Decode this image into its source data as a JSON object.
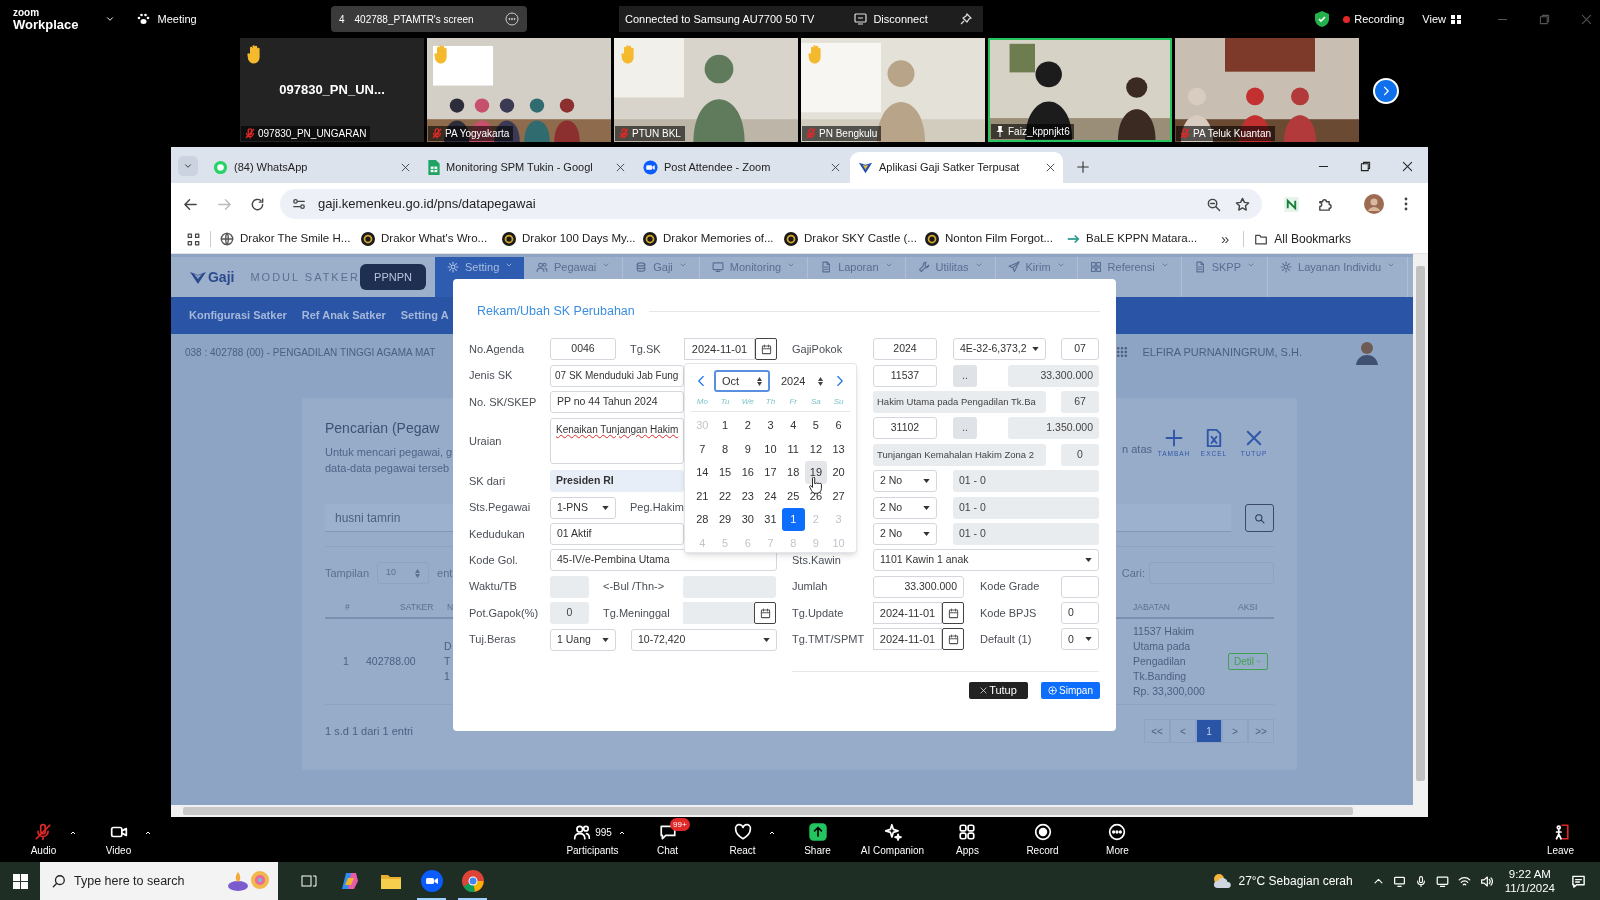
{
  "zoom_top_bar": {
    "logo_top": "zoom",
    "logo_bottom": "Workplace",
    "meeting": "Meeting",
    "share_count": "4",
    "share_label": "402788_PTAMTR's screen",
    "cast_status": "Connected to Samsung AU7700 50 TV",
    "disconnect": "Disconnect",
    "recording": "Recording",
    "view": "View"
  },
  "video_tiles": [
    {
      "kind": "avatar",
      "display_name": "097830_PN_UN...",
      "name": "097830_PN_UNGARAN",
      "hand_raised": true,
      "mic_muted": true,
      "pinned": false,
      "active_speaker": false
    },
    {
      "kind": "picture",
      "name": "PA Yogyakarta",
      "hand_raised": true,
      "mic_muted": true,
      "pinned": false,
      "active_speaker": false
    },
    {
      "kind": "picture",
      "name": "PTUN BKL",
      "hand_raised": true,
      "mic_muted": true,
      "pinned": false,
      "active_speaker": false
    },
    {
      "kind": "picture",
      "name": "PN Bengkulu",
      "hand_raised": true,
      "mic_muted": true,
      "pinned": false,
      "active_speaker": false
    },
    {
      "kind": "picture",
      "name": "Faiz_kppnjkt6",
      "hand_raised": false,
      "mic_muted": false,
      "pinned": true,
      "active_speaker": true
    },
    {
      "kind": "picture",
      "name": "PA Teluk Kuantan",
      "hand_raised": false,
      "mic_muted": true,
      "pinned": false,
      "active_speaker": false
    }
  ],
  "browser": {
    "tabs": [
      {
        "kind": "whatsapp",
        "title": "(84) WhatsApp",
        "selected": false
      },
      {
        "kind": "sheets",
        "title": "Monitoring SPM Tukin - Googl",
        "selected": false
      },
      {
        "kind": "zoom",
        "title": "Post Attendee - Zoom",
        "selected": false
      },
      {
        "kind": "gaji",
        "title": "Aplikasi Gaji Satker Terpusat",
        "selected": true
      }
    ],
    "url": "gaji.kemenkeu.go.id/pns/datapegawai",
    "bookmarks": [
      {
        "kind": "globe",
        "label": "Drakor The Smile H..."
      },
      {
        "kind": "cinema",
        "label": "Drakor What's Wro..."
      },
      {
        "kind": "cinema",
        "label": "Drakor 100 Days My..."
      },
      {
        "kind": "cinema",
        "label": "Drakor Memories of..."
      },
      {
        "kind": "cinema",
        "label": "Drakor SKY Castle (..."
      },
      {
        "kind": "cinema",
        "label": "Nonton Film Forgot..."
      },
      {
        "kind": "link",
        "label": "BaLE KPPN Matara..."
      }
    ],
    "overflow": "»",
    "all_bookmarks": "All Bookmarks"
  },
  "app": {
    "logo": "Gaji",
    "module": "MODUL SATKER",
    "ppnpn": "PPNPN",
    "menu": [
      {
        "kind": "gear",
        "label": "Setting",
        "selected": true
      },
      {
        "kind": "users",
        "label": "Pegawai",
        "selected": false
      },
      {
        "kind": "coins",
        "label": "Gaji",
        "selected": false
      },
      {
        "kind": "monitor",
        "label": "Monitoring",
        "selected": false
      },
      {
        "kind": "doc",
        "label": "Laporan",
        "selected": false
      },
      {
        "kind": "wrench",
        "label": "Utilitas",
        "selected": false
      },
      {
        "kind": "send",
        "label": "Kirim",
        "selected": false
      },
      {
        "kind": "grid",
        "label": "Referensi",
        "selected": false
      },
      {
        "kind": "doc",
        "label": "SKPP",
        "selected": false
      },
      {
        "kind": "gear",
        "label": "Layanan Individu",
        "selected": false
      }
    ],
    "subnav": [
      "Konfigurasi Satker",
      "Ref Anak Satker",
      "Setting A"
    ],
    "satker": "038 : 402788 (00) - PENGADILAN TINGGI AGAMA MAT",
    "user": "ELFIRA PURNANINGRUM, S.H.",
    "panel": {
      "title": "Pencarian (Pegaw",
      "description": [
        "Untuk mencari pegawai, g",
        "data-data pegawai terseb"
      ],
      "description_tail": "n atas",
      "actions": [
        {
          "kind": "add",
          "label": "TAMBAH"
        },
        {
          "kind": "excel",
          "label": "EXCEL"
        },
        {
          "kind": "close",
          "label": "TUTUP"
        }
      ],
      "search_value": "husni tamrin",
      "page_size_label": "Tampilan",
      "page_size": "10",
      "entries_label": "ent",
      "filter_label": "Cari:",
      "table": {
        "columns": [
          "#",
          "SATKER",
          "N"
        ],
        "right_columns": [
          "JABATAN",
          "AKSI"
        ],
        "rows": [
          {
            "no": "1",
            "satker": "402788.00",
            "column_3": [
              "D",
              "T",
              "1"
            ],
            "jabatan": [
              "11537 Hakim",
              "Utama pada",
              "Pengadilan",
              "Tk.Banding",
              "Rp. 33,300,000"
            ],
            "action": "Detil"
          }
        ]
      },
      "info": "1 s.d 1 dari 1 entri",
      "pagination": [
        {
          "label": "<<",
          "selected": false
        },
        {
          "label": "<",
          "selected": false
        },
        {
          "label": "1",
          "selected": true
        },
        {
          "label": ">",
          "selected": false
        },
        {
          "label": ">>",
          "selected": false
        }
      ]
    }
  },
  "modal": {
    "title": "Rekam/Ubah SK Perubahan",
    "left_rows": [
      {
        "label": "No.Agenda",
        "fields": [
          {
            "kind": "input",
            "value": "0046"
          },
          {
            "kind": "label",
            "value": "Tg.SK"
          },
          {
            "kind": "date",
            "value": "2024-11-01",
            "disabled": false
          }
        ]
      },
      {
        "label": "Jenis SK",
        "fields": [
          {
            "kind": "input",
            "value": "07 SK Menduduki Jab Fung"
          }
        ]
      },
      {
        "label": "No. SK/SKEP",
        "fields": [
          {
            "kind": "input",
            "value": "PP no 44 Tahun 2024"
          }
        ]
      },
      {
        "label": "Uraian",
        "fields": [
          {
            "kind": "textarea",
            "value": "Kenaikan Tunjangan Hakim",
            "misspelled": true
          }
        ]
      },
      {
        "label": "SK dari",
        "fields": [
          {
            "kind": "highlight",
            "value": "Presiden RI"
          }
        ]
      },
      {
        "label": "Sts.Pegawai",
        "fields": [
          {
            "kind": "select",
            "value": "1-PNS"
          },
          {
            "kind": "label",
            "value": "Peg.Hakim"
          }
        ]
      },
      {
        "label": "Kedudukan",
        "fields": [
          {
            "kind": "input",
            "value": "01 Aktif"
          }
        ]
      },
      {
        "label": "Kode Gol.",
        "fields": [
          {
            "kind": "input",
            "value": "45-IV/e-Pembina Utama"
          }
        ]
      },
      {
        "label": "Waktu/TB",
        "fields": [
          {
            "kind": "readonly"
          },
          {
            "kind": "label",
            "value": "<-Bul /Thn->"
          },
          {
            "kind": "readonly"
          }
        ]
      },
      {
        "label": "Pot.Gapok(%)",
        "fields": [
          {
            "kind": "readonly",
            "value": "0"
          },
          {
            "kind": "label",
            "value": "Tg.Meninggal"
          },
          {
            "kind": "date",
            "disabled": true
          }
        ]
      },
      {
        "label": "Tuj.Beras",
        "fields": [
          {
            "kind": "select",
            "value": "1 Uang"
          },
          {
            "kind": "select",
            "value": "10-72,420"
          }
        ]
      }
    ],
    "right_rows": [
      {
        "label": "GajiPokok",
        "fields": [
          {
            "kind": "input",
            "value": "2024"
          },
          {
            "kind": "select",
            "value": "4E-32-6,373,2"
          },
          {
            "kind": "input",
            "value": "07"
          }
        ]
      },
      {
        "fields": [
          {
            "kind": "input",
            "value": "11537"
          },
          {
            "kind": "button",
            "value": ".."
          },
          {
            "kind": "readonly",
            "value": "33.300.000"
          }
        ]
      },
      {
        "fields": [
          {
            "kind": "readonly",
            "value": "Hakim Utama pada Pengadilan Tk.Ba"
          },
          {
            "kind": "readonly",
            "value": "67"
          }
        ]
      },
      {
        "fields": [
          {
            "kind": "input",
            "value": "31102"
          },
          {
            "kind": "button",
            "value": ".."
          },
          {
            "kind": "readonly",
            "value": "1.350.000"
          }
        ]
      },
      {
        "fields": [
          {
            "kind": "readonly",
            "value": "Tunjangan Kemahalan Hakim Zona 2"
          },
          {
            "kind": "readonly",
            "value": "0"
          }
        ]
      },
      {
        "fields": [
          {
            "kind": "select",
            "value": "2 No"
          },
          {
            "kind": "readonly",
            "value": "01 - 0"
          }
        ]
      },
      {
        "fields": [
          {
            "kind": "select",
            "value": "2 No"
          },
          {
            "kind": "readonly",
            "value": "01 - 0"
          }
        ]
      },
      {
        "fields": [
          {
            "kind": "select",
            "value": "2 No"
          },
          {
            "kind": "readonly",
            "value": "01 - 0"
          }
        ]
      },
      {
        "label": "Sts.Kawin",
        "fields": [
          {
            "kind": "select",
            "value": "1101 Kawin 1 anak"
          }
        ]
      },
      {
        "label": "Jumlah",
        "fields": [
          {
            "kind": "input",
            "value": "33.300.000"
          },
          {
            "kind": "label",
            "value": "Kode Grade"
          },
          {
            "kind": "input"
          }
        ]
      },
      {
        "label": "Tg.Update",
        "fields": [
          {
            "kind": "date",
            "value": "2024-11-01",
            "disabled": false
          },
          {
            "kind": "label",
            "value": "Kode BPJS"
          },
          {
            "kind": "input",
            "value": "0"
          }
        ]
      },
      {
        "label": "Tg.TMT/SPMT",
        "fields": [
          {
            "kind": "date",
            "value": "2024-11-01",
            "disabled": false
          },
          {
            "kind": "label",
            "value": "Default (1)"
          },
          {
            "kind": "select",
            "value": "0"
          }
        ]
      }
    ],
    "date_picker": {
      "month": "Oct",
      "year": "2024",
      "weekdays": [
        "Mo",
        "Tu",
        "We",
        "Th",
        "Fr",
        "Sa",
        "Su"
      ],
      "days": [
        {
          "label": "30",
          "outside": true,
          "selected": false,
          "hovered": false
        },
        {
          "label": "1",
          "outside": false,
          "selected": false,
          "hovered": false
        },
        {
          "label": "2",
          "outside": false,
          "selected": false,
          "hovered": false
        },
        {
          "label": "3",
          "outside": false,
          "selected": false,
          "hovered": false
        },
        {
          "label": "4",
          "outside": false,
          "selected": false,
          "hovered": false
        },
        {
          "label": "5",
          "outside": false,
          "selected": false,
          "hovered": false
        },
        {
          "label": "6",
          "outside": false,
          "selected": false,
          "hovered": false
        },
        {
          "label": "7",
          "outside": false,
          "selected": false,
          "hovered": false
        },
        {
          "label": "8",
          "outside": false,
          "selected": false,
          "hovered": false
        },
        {
          "label": "9",
          "outside": false,
          "selected": false,
          "hovered": false
        },
        {
          "label": "10",
          "outside": false,
          "selected": false,
          "hovered": false
        },
        {
          "label": "11",
          "outside": false,
          "selected": false,
          "hovered": false
        },
        {
          "label": "12",
          "outside": false,
          "selected": false,
          "hovered": false
        },
        {
          "label": "13",
          "outside": false,
          "selected": false,
          "hovered": false
        },
        {
          "label": "14",
          "outside": false,
          "selected": false,
          "hovered": false
        },
        {
          "label": "15",
          "outside": false,
          "selected": false,
          "hovered": false
        },
        {
          "label": "16",
          "outside": false,
          "selected": false,
          "hovered": false
        },
        {
          "label": "17",
          "outside": false,
          "selected": false,
          "hovered": false
        },
        {
          "label": "18",
          "outside": false,
          "selected": false,
          "hovered": false
        },
        {
          "label": "19",
          "outside": false,
          "selected": false,
          "hovered": true
        },
        {
          "label": "20",
          "outside": false,
          "selected": false,
          "hovered": false
        },
        {
          "label": "21",
          "outside": false,
          "selected": false,
          "hovered": false
        },
        {
          "label": "22",
          "outside": false,
          "selected": false,
          "hovered": false
        },
        {
          "label": "23",
          "outside": false,
          "selected": false,
          "hovered": false
        },
        {
          "label": "24",
          "outside": false,
          "selected": false,
          "hovered": false
        },
        {
          "label": "25",
          "outside": false,
          "selected": false,
          "hovered": false
        },
        {
          "label": "26",
          "outside": false,
          "selected": false,
          "hovered": false
        },
        {
          "label": "27",
          "outside": false,
          "selected": false,
          "hovered": false
        },
        {
          "label": "28",
          "outside": false,
          "selected": false,
          "hovered": false
        },
        {
          "label": "29",
          "outside": false,
          "selected": false,
          "hovered": false
        },
        {
          "label": "30",
          "outside": false,
          "selected": false,
          "hovered": false
        },
        {
          "label": "31",
          "outside": false,
          "selected": false,
          "hovered": false
        },
        {
          "label": "1",
          "outside": true,
          "selected": true,
          "hovered": false
        },
        {
          "label": "2",
          "outside": true,
          "selected": false,
          "hovered": false
        },
        {
          "label": "3",
          "outside": true,
          "selected": false,
          "hovered": false
        },
        {
          "label": "4",
          "outside": true,
          "selected": false,
          "hovered": false
        },
        {
          "label": "5",
          "outside": true,
          "selected": false,
          "hovered": false
        },
        {
          "label": "6",
          "outside": true,
          "selected": false,
          "hovered": false
        },
        {
          "label": "7",
          "outside": true,
          "selected": false,
          "hovered": false
        },
        {
          "label": "8",
          "outside": true,
          "selected": false,
          "hovered": false
        },
        {
          "label": "9",
          "outside": true,
          "selected": false,
          "hovered": false
        },
        {
          "label": "10",
          "outside": true,
          "selected": false,
          "hovered": false
        }
      ]
    },
    "buttons": [
      {
        "kind": "close",
        "label": "Tutup"
      },
      {
        "kind": "save",
        "label": "Simpan"
      }
    ]
  },
  "meeting_controls": [
    {
      "kind": "audio",
      "label": "Audio",
      "caret": true
    },
    {
      "kind": "video",
      "label": "Video",
      "caret": true
    },
    {
      "kind": "participants",
      "label": "Participants",
      "count": "995",
      "caret": true
    },
    {
      "kind": "chat",
      "label": "Chat",
      "badge": "99+",
      "caret": false
    },
    {
      "kind": "react",
      "label": "React",
      "caret": true
    },
    {
      "kind": "share",
      "label": "Share",
      "caret": false
    },
    {
      "kind": "ai",
      "label": "AI Companion",
      "caret": false
    },
    {
      "kind": "apps",
      "label": "Apps",
      "caret": false
    },
    {
      "kind": "record",
      "label": "Record",
      "caret": false
    },
    {
      "kind": "more",
      "label": "More",
      "caret": false
    },
    {
      "kind": "leave",
      "label": "Leave",
      "caret": false
    }
  ],
  "taskbar": {
    "search_placeholder": "Type here to search",
    "apps": [
      {
        "kind": "taskview",
        "running": false
      },
      {
        "kind": "copilot",
        "running": false
      },
      {
        "kind": "explorer",
        "running": false
      },
      {
        "kind": "zoom",
        "running": true
      },
      {
        "kind": "chrome",
        "running": true
      }
    ],
    "weather": "27°C Sebagian cerah",
    "time": "9:22 AM",
    "date": "11/1/2024"
  }
}
